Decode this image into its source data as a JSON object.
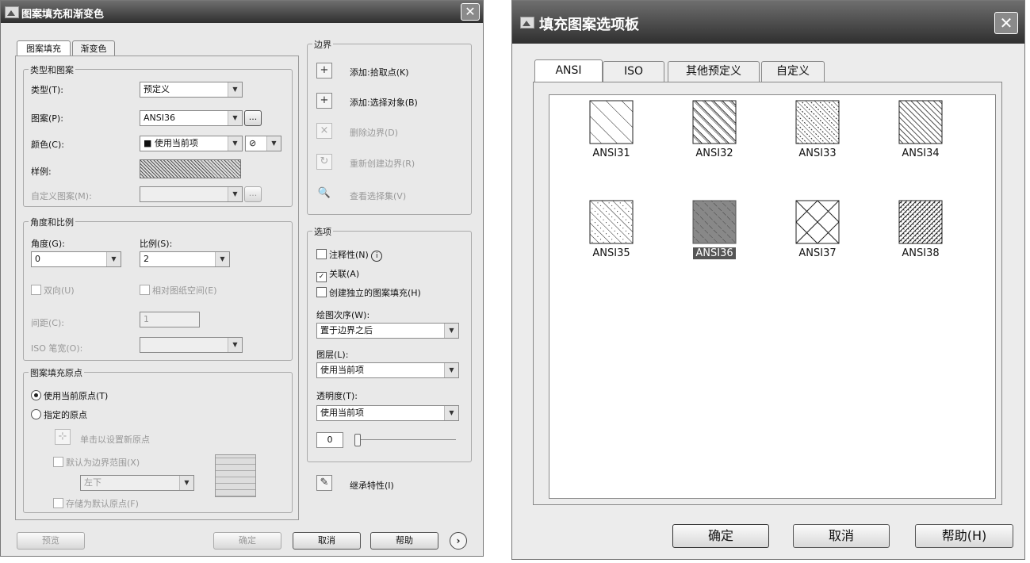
{
  "left": {
    "title": "图案填充和渐变色",
    "close": "✕",
    "tabs": [
      "图案填充",
      "渐变色"
    ],
    "type_pattern": {
      "label": "类型和图案",
      "type_label": "类型(T):",
      "type_value": "预定义",
      "pattern_label": "图案(P):",
      "pattern_value": "ANSI36",
      "browse": "...",
      "color_label": "颜色(C):",
      "color_value": "■ 使用当前项",
      "sample_label": "样例:",
      "custom_label": "自定义图案(M):"
    },
    "angle_scale": {
      "label": "角度和比例",
      "angle_label": "角度(G):",
      "angle_value": "0",
      "scale_label": "比例(S):",
      "scale_value": "2",
      "double_label": "双向(U)",
      "relative_label": "相对图纸空间(E)",
      "spacing_label": "间距(C):",
      "spacing_value": "1",
      "iso_label": "ISO 笔宽(O):"
    },
    "origin": {
      "label": "图案填充原点",
      "use_current": "使用当前原点(T)",
      "specified": "指定的原点",
      "click_set": "单击以设置新原点",
      "default_boundary": "默认为边界范围(X)",
      "boundary_value": "左下",
      "store_default": "存储为默认原点(F)"
    },
    "boundaries": {
      "label": "边界",
      "add_pick": "添加:拾取点(K)",
      "add_select": "添加:选择对象(B)",
      "remove": "删除边界(D)",
      "recreate": "重新创建边界(R)",
      "view": "查看选择集(V)"
    },
    "options": {
      "label": "选项",
      "annotative": "注释性(N)",
      "associative": "关联(A)",
      "separate": "创建独立的图案填充(H)",
      "draw_order_label": "绘图次序(W):",
      "draw_order_value": "置于边界之后",
      "layer_label": "图层(L):",
      "layer_value": "使用当前项",
      "transparency_label": "透明度(T):",
      "transparency_value": "使用当前项",
      "transparency_num": "0"
    },
    "inherit": "继承特性(I)",
    "buttons": {
      "preview": "预览",
      "ok": "确定",
      "cancel": "取消",
      "help": "帮助"
    }
  },
  "right": {
    "title": "填充图案选项板",
    "close": "✕",
    "tabs": [
      "ANSI",
      "ISO",
      "其他预定义",
      "自定义"
    ],
    "patterns": [
      "ANSI31",
      "ANSI32",
      "ANSI33",
      "ANSI34",
      "ANSI35",
      "ANSI36",
      "ANSI37",
      "ANSI38"
    ],
    "selected": "ANSI36",
    "buttons": {
      "ok": "确定",
      "cancel": "取消",
      "help": "帮助(H)"
    }
  }
}
